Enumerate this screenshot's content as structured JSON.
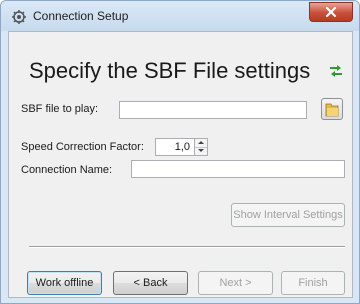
{
  "window": {
    "title": "Connection Setup"
  },
  "page": {
    "heading": "Specify the SBF File settings"
  },
  "form": {
    "sbf_file_label": "SBF file to play:",
    "sbf_file_value": "",
    "speed_label": "Speed Correction Factor:",
    "speed_value": "1,0",
    "connection_name_label": "Connection Name:",
    "connection_name_value": ""
  },
  "buttons": {
    "show_interval": "Show Interval Settings",
    "work_offline": "Work offline",
    "back": "< Back",
    "next": "Next >",
    "finish": "Finish"
  },
  "icons": {
    "app": "gear-icon",
    "close": "close-icon",
    "switch": "swap-arrows-icon",
    "folder": "folder-icon"
  },
  "colors": {
    "accent_green": "#2e9e2a",
    "close_red": "#c8503a"
  }
}
